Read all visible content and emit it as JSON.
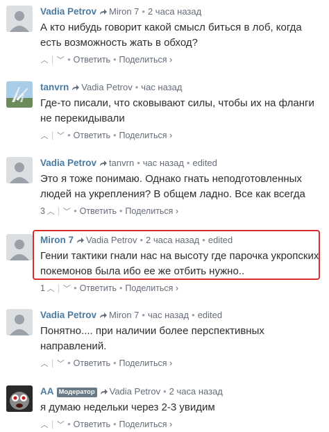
{
  "comments": [
    {
      "author": "Vadia Petrov",
      "reply_to": "Miron 7",
      "time": "2 часа назад",
      "edited": "",
      "badge": "",
      "text": "А кто нибудь говорит какой смысл биться в лоб, когда есть возможность жать в обход?",
      "votes": "",
      "reply": "Ответить",
      "share": "Поделиться ›",
      "avatar": "default-avatar"
    },
    {
      "author": "tanvrn",
      "reply_to": "Vadia Petrov",
      "time": "час назад",
      "edited": "",
      "badge": "",
      "text": "Где-то писали, что сковывают силы, чтобы их на фланги не перекидывали",
      "votes": "",
      "reply": "Ответить",
      "share": "Поделиться ›",
      "avatar": "landscape-avatar"
    },
    {
      "author": "Vadia Petrov",
      "reply_to": "tanvrn",
      "time": "час назад",
      "edited": "edited",
      "badge": "",
      "text": "Это я тоже понимаю. Однако гнать неподготовленных людей на укрепления? В общем ладно. Все как всегда",
      "votes": "3",
      "reply": "Ответить",
      "share": "Поделиться ›",
      "avatar": "default-avatar"
    },
    {
      "author": "Miron 7",
      "reply_to": "Vadia Petrov",
      "time": "2 часа назад",
      "edited": "edited",
      "badge": "",
      "text": "Гении тактики гнали нас на высоту где парочка укропских покемонов была ибо ее же отбить нужно..",
      "votes": "1",
      "reply": "Ответить",
      "share": "Поделиться ›",
      "avatar": "default-avatar"
    },
    {
      "author": "Vadia Petrov",
      "reply_to": "Miron 7",
      "time": "час назад",
      "edited": "edited",
      "badge": "",
      "text": "Понятно.... при наличии более перспективных направлений.",
      "votes": "",
      "reply": "Ответить",
      "share": "Поделиться ›",
      "avatar": "default-avatar"
    },
    {
      "author": "AA",
      "reply_to": "Vadia Petrov",
      "time": "2 часа назад",
      "edited": "",
      "badge": "Модератор",
      "text": "я думаю недельки через 2-3 увидим",
      "votes": "",
      "reply": "Ответить",
      "share": "Поделиться ›",
      "avatar": "monster-avatar"
    }
  ],
  "colors": {
    "author": "#4a7aa1",
    "highlight": "#d92c2c",
    "meta": "#656c7a"
  }
}
